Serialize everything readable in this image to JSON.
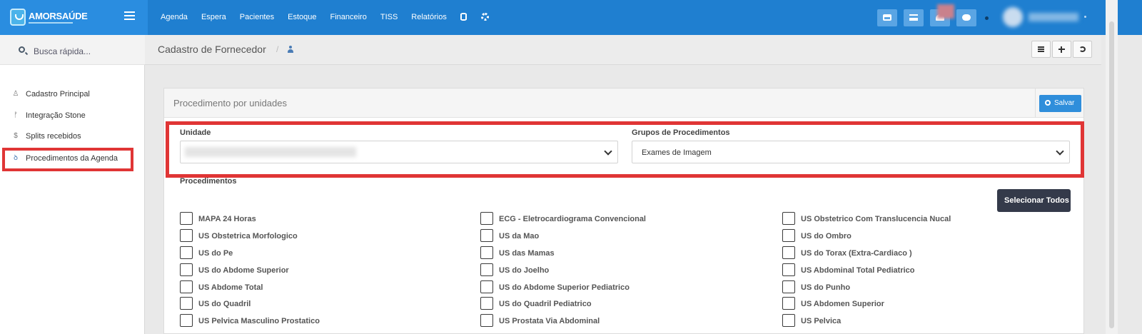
{
  "brand": {
    "name": "AMORSAÚDE"
  },
  "topnav": {
    "items": [
      "Agenda",
      "Espera",
      "Pacientes",
      "Estoque",
      "Financeiro",
      "TISS",
      "Relatórios"
    ],
    "icons": [
      "database-icon",
      "settings-icon"
    ],
    "right_icons": [
      "inbox-icon",
      "list-icon",
      "bell-icon",
      "chat-icon"
    ]
  },
  "sidebar": {
    "search_label": "Busca rápida...",
    "items": [
      {
        "label": "Cadastro Principal",
        "icon": "building-icon"
      },
      {
        "label": "Integração Stone",
        "icon": "fork-icon"
      },
      {
        "label": "Splits recebidos",
        "icon": "dollar-icon"
      },
      {
        "label": "Procedimentos da Agenda",
        "icon": "stethoscope-icon"
      }
    ]
  },
  "page": {
    "title": "Cadastro de Fornecedor",
    "breadcrumb_sep": "/"
  },
  "panel": {
    "title": "Procedimento por unidades",
    "save_label": "Salvar",
    "unidade_label": "Unidade",
    "grupos_label": "Grupos de Procedimentos",
    "grupos_value": "Exames de Imagem",
    "procedimentos_label": "Procedimentos",
    "select_all_label": "Selecionar Todos"
  },
  "procedures": [
    [
      "MAPA 24 Horas",
      "ECG - Eletrocardiograma Convencional",
      "US Obstetrico Com Translucencia Nucal"
    ],
    [
      "US Obstetrica Morfologico",
      "US da Mao",
      "US do Ombro"
    ],
    [
      "US do Pe",
      "US das Mamas",
      "US do Torax (Extra-Cardiaco )"
    ],
    [
      "US do Abdome Superior",
      "US do Joelho",
      "US Abdominal Total Pediatrico"
    ],
    [
      "US Abdome Total",
      "US do Abdome Superior Pediatrico",
      "US do Punho"
    ],
    [
      "US do Quadril",
      "US do Quadril Pediatrico",
      "US Abdomen Superior"
    ],
    [
      "US Pelvica Masculino Prostatico",
      "US Prostata Via Abdominal",
      "US Pelvica"
    ]
  ],
  "colors": {
    "topbar": "#1f7fd0",
    "highlight": "#e03535",
    "save": "#2f8edb",
    "select_all": "#343a4a"
  }
}
